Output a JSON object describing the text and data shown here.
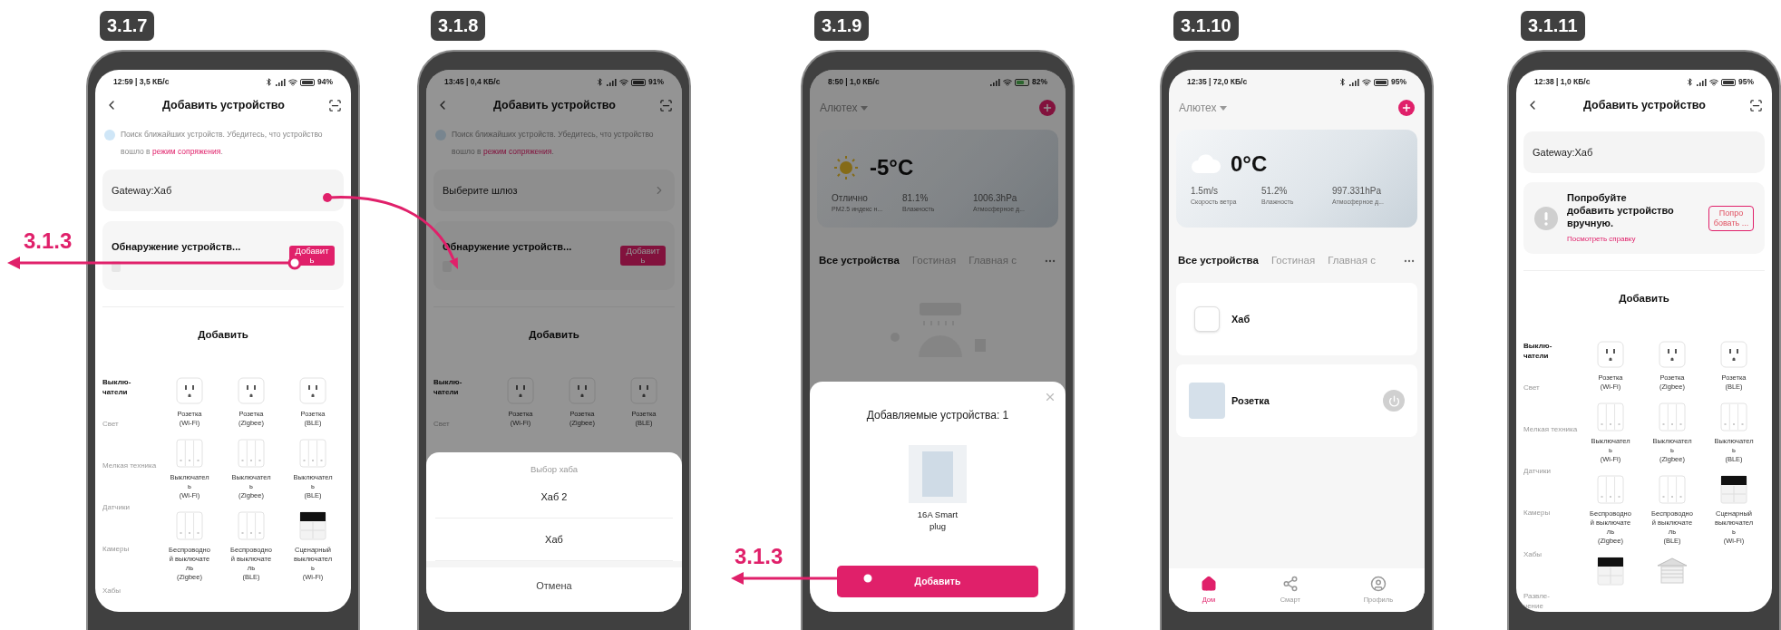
{
  "phones": [
    {
      "step": "3.1.7",
      "dimmed": false,
      "status": {
        "time": "12:59 | 3,5 КБ/с",
        "battery": "94%",
        "bluetooth": true,
        "charging": false
      },
      "screen": {
        "kind": "add_device",
        "title": "Добавить устройство",
        "notice": {
          "text": "Поиск ближайших устройств. Убедитесь, что устройство вошло в",
          "link": "режим сопряжения",
          "end": "."
        },
        "gateway": {
          "label": "Gateway:Хаб",
          "chevron": false
        },
        "card": {
          "kind": "discovery",
          "title": "Обнаружение устройств...",
          "button": "Добавит\nь"
        },
        "section_title": "Добавить",
        "categories": [
          {
            "label": "Выклю-\nчатели",
            "selected": true
          },
          {
            "label": "Свет",
            "selected": false
          },
          {
            "label": "Мелкая техника",
            "selected": false
          },
          {
            "label": "Датчики",
            "selected": false
          },
          {
            "label": "Камеры",
            "selected": false
          },
          {
            "label": "Хабы",
            "selected": false
          }
        ],
        "devices": [
          {
            "kind": "socket",
            "name": "Розетка\n(Wi-Fi)"
          },
          {
            "kind": "socket",
            "name": "Розетка\n(Zigbee)"
          },
          {
            "kind": "socket",
            "name": "Розетка\n(BLE)"
          },
          {
            "kind": "switch",
            "name": "Выключател\nь\n(Wi-Fi)"
          },
          {
            "kind": "switch",
            "name": "Выключател\nь\n(Zigbee)"
          },
          {
            "kind": "switch",
            "name": "Выключател\nь\n(BLE)"
          },
          {
            "kind": "switch",
            "name": "Беспроводно\nй выключате\nль\n(Zigbee)"
          },
          {
            "kind": "switch",
            "name": "Беспроводно\nй выключате\nль\n(BLE)"
          },
          {
            "kind": "scene",
            "name": "Сценарный\nвыключател\nь\n(Wi-Fi)"
          }
        ]
      }
    },
    {
      "step": "3.1.8",
      "dimmed": true,
      "status": {
        "time": "13:45 | 0,4 КБ/с",
        "battery": "91%",
        "bluetooth": true,
        "charging": false
      },
      "screen": {
        "kind": "add_device",
        "title": "Добавить устройство",
        "notice": {
          "text": "Поиск ближайших устройств. Убедитесь, что устройство вошло в",
          "link": "режим сопряжения",
          "end": "."
        },
        "gateway": {
          "label": "Выберите шлюз",
          "chevron": true
        },
        "card": {
          "kind": "discovery",
          "title": "Обнаружение устройств...",
          "button": "Добавит\nь"
        },
        "section_title": "Добавить",
        "categories": [
          {
            "label": "Выклю-\nчатели",
            "selected": true
          },
          {
            "label": "Свет",
            "selected": false
          }
        ],
        "devices": [
          {
            "kind": "socket",
            "name": "Розетка\n(Wi-Fi)"
          },
          {
            "kind": "socket",
            "name": "Розетка\n(Zigbee)"
          },
          {
            "kind": "socket",
            "name": "Розетка\n(BLE)"
          }
        ]
      },
      "sheet": {
        "kind": "hub_picker",
        "title": "Выбор хаба",
        "options": [
          "Хаб 2",
          "Хаб"
        ],
        "cancel": "Отмена"
      }
    },
    {
      "step": "3.1.9",
      "dimmed": true,
      "status": {
        "time": "8:50 | 1,0 КБ/с",
        "battery": "82%",
        "bluetooth": false,
        "charging": true
      },
      "screen": {
        "kind": "home",
        "home_name": "Алютех",
        "weather": {
          "kind": "sunny",
          "temp": "-5°C",
          "stats": [
            {
              "value": "Отлично",
              "label": "PM2.5 индекс н..."
            },
            {
              "value": "81.1%",
              "label": "Влажность"
            },
            {
              "value": "1006.3hPa",
              "label": "Атмосферное д..."
            }
          ]
        },
        "tabs": [
          {
            "label": "Все устройства",
            "selected": true
          },
          {
            "label": "Гостиная",
            "selected": false
          },
          {
            "label": "Главная с",
            "selected": false
          }
        ],
        "empty_state": true
      },
      "sheet": {
        "kind": "found_devices",
        "title": "Добавляемые устройства: 1",
        "devices": [
          "16A Smart\nplug"
        ],
        "button": "Добавить"
      }
    },
    {
      "step": "3.1.10",
      "dimmed": false,
      "status": {
        "time": "12:35 | 72,0 КБ/с",
        "battery": "95%",
        "bluetooth": true,
        "charging": false
      },
      "screen": {
        "kind": "home",
        "home_name": "Алютех",
        "weather": {
          "kind": "cloudy",
          "temp": "0°C",
          "stats": [
            {
              "value": "1.5m/s",
              "label": "Скорость ветра"
            },
            {
              "value": "51.2%",
              "label": "Влажность"
            },
            {
              "value": "997.331hPa",
              "label": "Атмосферное д..."
            }
          ]
        },
        "tabs": [
          {
            "label": "Все устройства",
            "selected": true
          },
          {
            "label": "Гостиная",
            "selected": false
          },
          {
            "label": "Главная с",
            "selected": false
          }
        ],
        "devices": [
          {
            "kind": "hub",
            "name": "Хаб",
            "power_button": false
          },
          {
            "kind": "plug",
            "name": "Розетка",
            "power_button": true
          }
        ],
        "nav": [
          {
            "label": "Дом",
            "selected": true
          },
          {
            "label": "Смарт",
            "selected": false
          },
          {
            "label": "Профиль",
            "selected": false
          }
        ]
      }
    },
    {
      "step": "3.1.11",
      "dimmed": false,
      "status": {
        "time": "12:38 | 1,0 КБ/с",
        "battery": "95%",
        "bluetooth": true,
        "charging": false
      },
      "screen": {
        "kind": "add_device",
        "title": "Добавить устройство",
        "gateway": {
          "label": "Gateway:Хаб",
          "chevron": false
        },
        "card": {
          "kind": "manual",
          "title": "Попробуйте добавить устройство вручную.",
          "link": "Посмотреть справку",
          "button": "Попро\nбовать ..."
        },
        "section_title": "Добавить",
        "categories": [
          {
            "label": "Выклю-\nчатели",
            "selected": true
          },
          {
            "label": "Свет",
            "selected": false
          },
          {
            "label": "Мелкая техника",
            "selected": false
          },
          {
            "label": "Датчики",
            "selected": false
          },
          {
            "label": "Камеры",
            "selected": false
          },
          {
            "label": "Хабы",
            "selected": false
          },
          {
            "label": "Развле-\nчение",
            "selected": false
          }
        ],
        "devices": [
          {
            "kind": "socket",
            "name": "Розетка\n(Wi-Fi)"
          },
          {
            "kind": "socket",
            "name": "Розетка\n(Zigbee)"
          },
          {
            "kind": "socket",
            "name": "Розетка\n(BLE)"
          },
          {
            "kind": "switch",
            "name": "Выключател\nь\n(Wi-Fi)"
          },
          {
            "kind": "switch",
            "name": "Выключател\nь\n(Zigbee)"
          },
          {
            "kind": "switch",
            "name": "Выключател\nь\n(BLE)"
          },
          {
            "kind": "switch",
            "name": "Беспроводно\nй выключате\nль\n(Zigbee)"
          },
          {
            "kind": "switch",
            "name": "Беспроводно\nй выключате\nль\n(BLE)"
          },
          {
            "kind": "scene",
            "name": "Сценарный\nвыключател\nь\n(Wi-Fi)"
          },
          {
            "kind": "scene"
          },
          {
            "kind": "garage"
          }
        ]
      }
    }
  ],
  "jump_labels": [
    "3.1.3",
    "3.1.3"
  ]
}
